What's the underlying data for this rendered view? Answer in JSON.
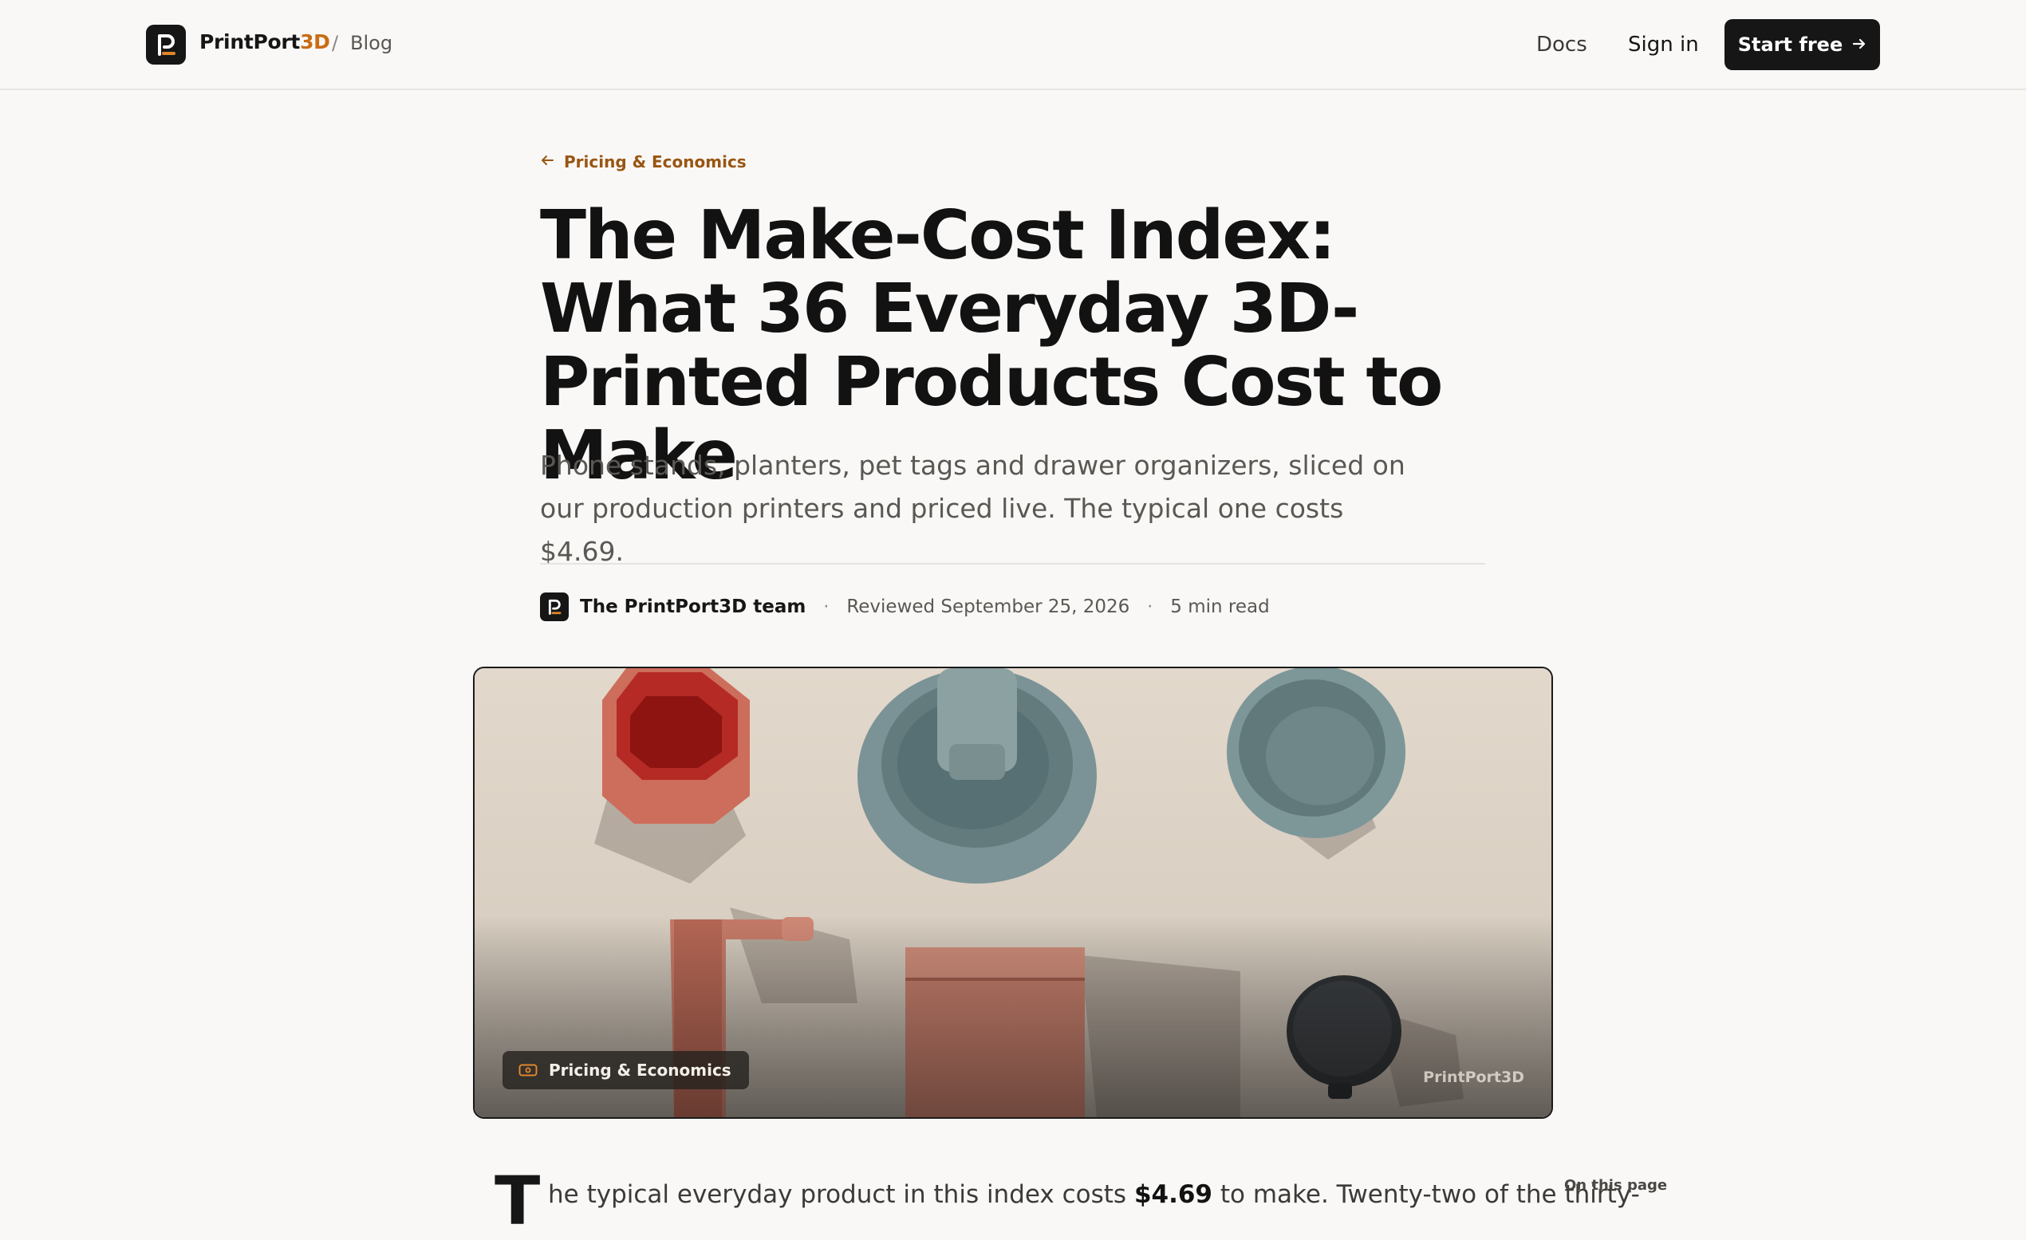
{
  "nav": {
    "brand_main": "PrintPort",
    "brand_accent": "3D",
    "crumb_separator": "/",
    "crumb": "Blog",
    "docs": "Docs",
    "sign_in": "Sign in",
    "start_free": "Start free"
  },
  "article": {
    "category": "Pricing & Economics",
    "title": "The Make-Cost Index: What 36 Everyday 3D-Printed Products Cost to Make",
    "subtitle": "Phone stands, planters, pet tags and drawer organizers, sliced on our production printers and priced live. The typical one costs $4.69.",
    "author": "The PrintPort3D team",
    "separator": "·",
    "reviewed": "Reviewed September 25, 2026",
    "read_time": "5 min read"
  },
  "hero": {
    "badge": "Pricing & Economics",
    "watermark": "PrintPort3D"
  },
  "body": {
    "dropcap": "T",
    "lead_before": "he typical everyday product in this index costs ",
    "lead_bold": "$4.69",
    "lead_after": " to make. Twenty-two of the thirty-",
    "toc_title": "On this page"
  },
  "colors": {
    "background": "#f9f8f6",
    "ink": "#161616",
    "accent": "#c86d14",
    "category_link": "#9a5513"
  },
  "icons": {
    "logo": "printport-logo-icon",
    "arrow_right": "arrow-right-icon",
    "arrow_left": "arrow-left-icon",
    "badge": "tag-icon"
  }
}
